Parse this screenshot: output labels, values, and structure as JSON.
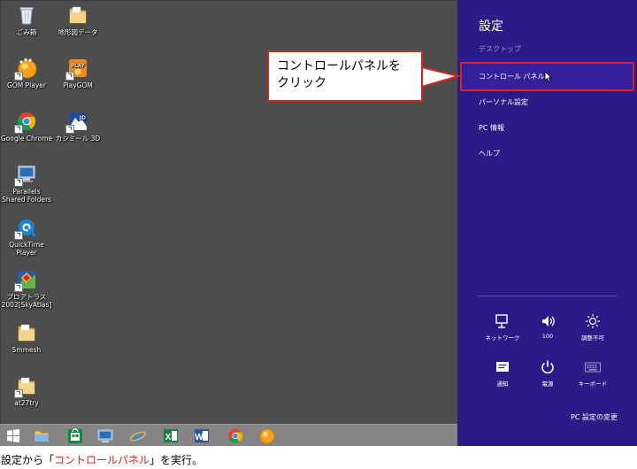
{
  "desktop": {
    "icons": [
      {
        "label": "ごみ箱",
        "icon": "recycle-bin-icon"
      },
      {
        "label": "地形図データ",
        "icon": "folder-icon"
      },
      {
        "label": "GOM Player",
        "icon": "gom-player-icon"
      },
      {
        "label": "PlayGOM",
        "icon": "playgom-icon"
      },
      {
        "label": "Google Chrome",
        "icon": "chrome-icon"
      },
      {
        "label": "カシミール 3D",
        "icon": "kashmir-3d-icon"
      },
      {
        "label": "Parallels Shared Folders",
        "icon": "parallels-folder-icon"
      },
      {
        "label": "QuickTime Player",
        "icon": "quicktime-icon"
      },
      {
        "label": "プロアトラス 2002[SkyAtlas]",
        "icon": "proatlas-icon"
      },
      {
        "label": "5mmesh",
        "icon": "folder-icon"
      },
      {
        "label": "at27try",
        "icon": "folder-icon"
      }
    ]
  },
  "settings": {
    "title": "設定",
    "desktop_label": "デスクトップ",
    "items": [
      "コントロール パネル",
      "パーソナル設定",
      "PC 情報",
      "ヘルプ"
    ],
    "quick": [
      {
        "label": "ネットワーク",
        "icon": "network-icon"
      },
      {
        "label": "100",
        "icon": "volume-icon"
      },
      {
        "label": "調整不可",
        "icon": "brightness-icon"
      },
      {
        "label": "通知",
        "icon": "notifications-icon"
      },
      {
        "label": "電源",
        "icon": "power-icon"
      },
      {
        "label": "キーボード",
        "icon": "keyboard-icon"
      }
    ],
    "pc_settings_link": "PC 設定の変更"
  },
  "taskbar": {
    "buttons": [
      "start-icon",
      "file-explorer-icon",
      "store-icon",
      "remote-icon",
      "internet-explorer-icon",
      "excel-icon",
      "word-icon",
      "chrome-icon",
      "gom-player-icon"
    ]
  },
  "callout": {
    "line1": "コントロールパネルを",
    "line2": "クリック"
  },
  "caption": {
    "before": "設定から「",
    "highlight": "コントロールパネル",
    "after": "」を実行。"
  },
  "colors": {
    "settings_bg": "#2e1a87",
    "desktop_bg": "#4d4d4d",
    "highlight_red": "#d9221c"
  }
}
